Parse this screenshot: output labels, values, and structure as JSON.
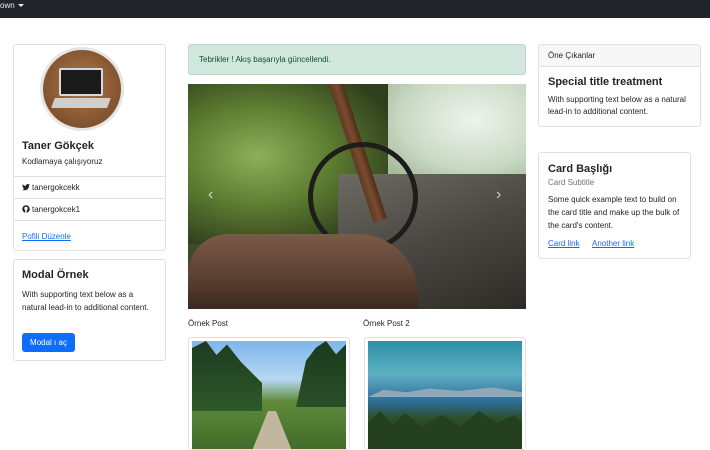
{
  "navbar": {
    "dropdown_label": "own"
  },
  "profile": {
    "name": "Taner Gökçek",
    "tagline": "Kodlamaya çalışıyoruz",
    "twitter": "tanergokcekk",
    "github": "tanergokcek1",
    "edit_link": "Pofili Düzenle"
  },
  "modal_card": {
    "title": "Modal Örnek",
    "text": "With supporting text below as a natural lead-in to additional content.",
    "button": "Modal ı aç"
  },
  "alert": {
    "text": "Tebrikler ! Akış başarıyla güncellendi."
  },
  "carousel": {
    "prev": "‹",
    "next": "›"
  },
  "posts": [
    {
      "title": "Örnek Post"
    },
    {
      "title": "Örnek Post 2"
    }
  ],
  "featured": {
    "header": "Öne Çıkanlar",
    "title": "Special title treatment",
    "text": "With supporting text below as a natural lead-in to additional content."
  },
  "card2": {
    "title": "Card Başlığı",
    "subtitle": "Card Subtitle",
    "text": "Some quick example text to build on the card title and make up the bulk of the card's content.",
    "link1": "Card link",
    "link2": "Another link"
  },
  "colors": {
    "primary": "#0d6efd",
    "success_bg": "#d1e7dd",
    "navbar": "#212529"
  }
}
